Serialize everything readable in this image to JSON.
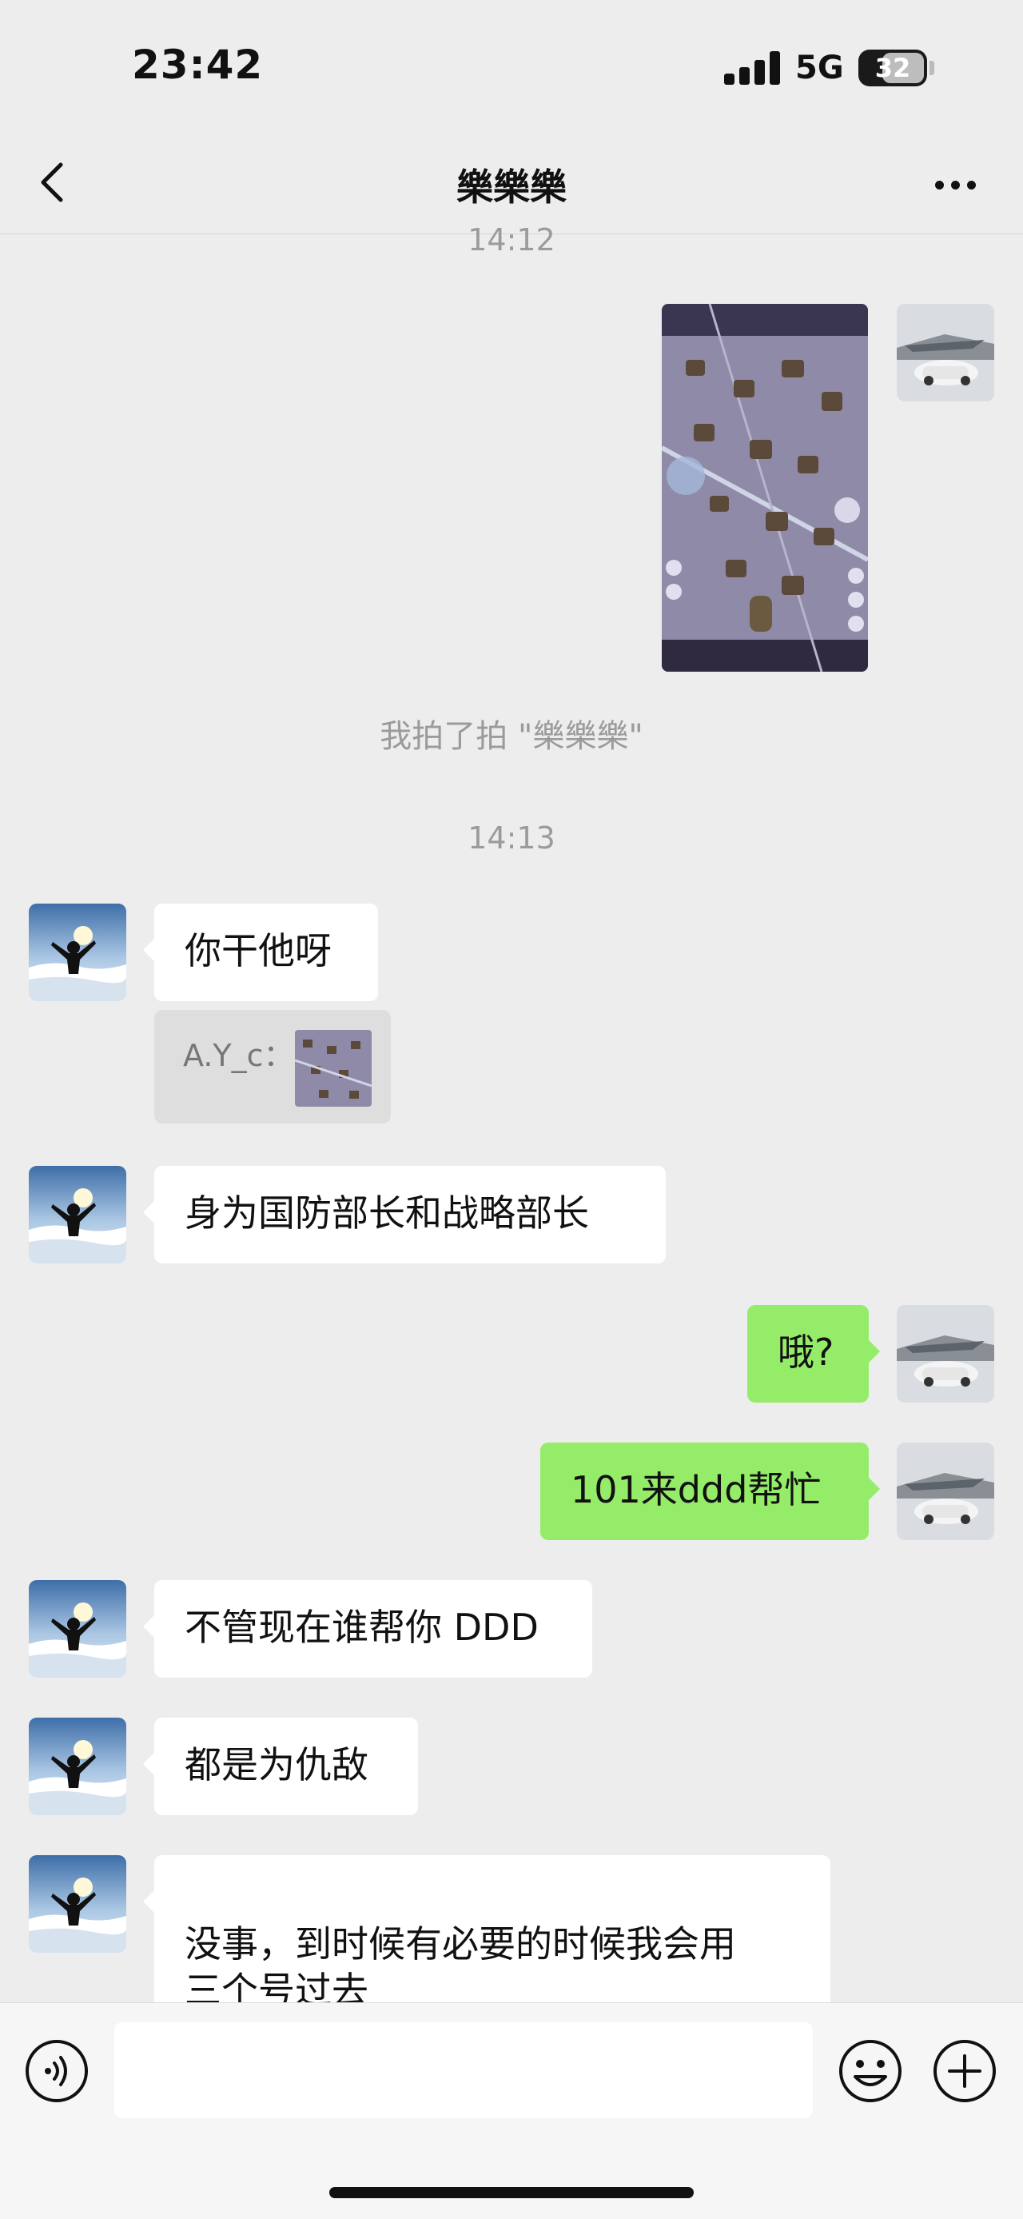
{
  "status_bar": {
    "time": "23:42",
    "network": "5G",
    "battery": "32"
  },
  "header": {
    "title": "樂樂樂"
  },
  "timestamps": {
    "t1": "14:12",
    "t2": "14:13"
  },
  "system": {
    "pat": "我拍了拍 \"樂樂樂\""
  },
  "messages": [
    {
      "text": "你干他呀"
    },
    {
      "text": "身为国防部长和战略部长"
    },
    {
      "text": "哦?"
    },
    {
      "text": "101来ddd帮忙"
    },
    {
      "text": "不管现在谁帮你 DDD"
    },
    {
      "text": "都是为仇敌"
    },
    {
      "text": "没事，到时候有必要的时候我会用\n三个号过去"
    }
  ],
  "quote": {
    "name": "A.Y_c："
  },
  "input": {
    "placeholder": ""
  },
  "colors": {
    "background": "#ededed",
    "outgoing_bubble": "#95ec69",
    "incoming_bubble": "#ffffff"
  },
  "icons": [
    "chevron-left-icon",
    "more-icon",
    "voice-icon",
    "emoji-icon",
    "plus-icon"
  ]
}
